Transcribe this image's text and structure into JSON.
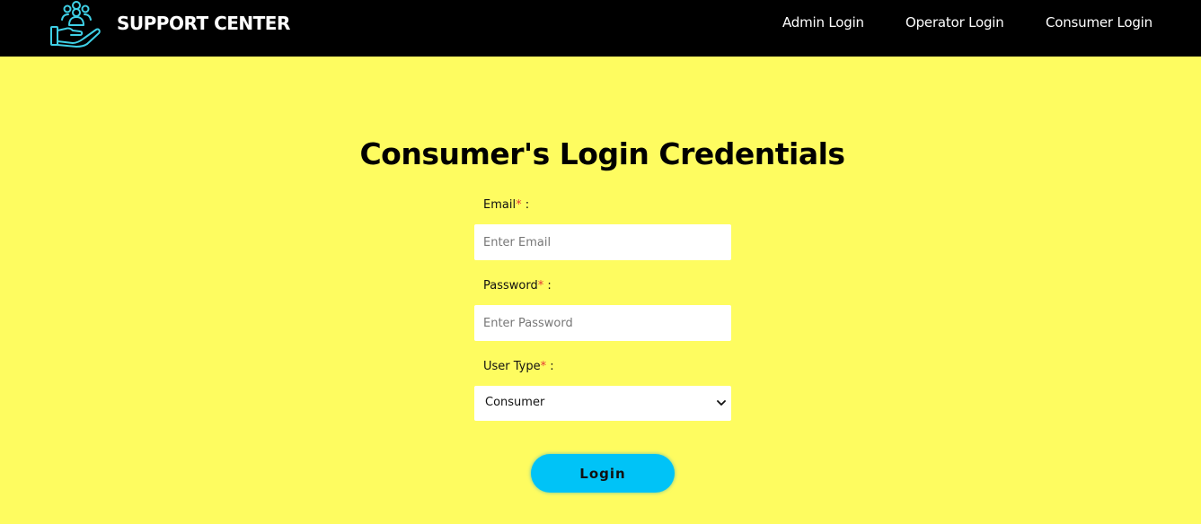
{
  "navbar": {
    "brand_name": "SUPPORT CENTER",
    "logo_icon": "helping-hand-people-icon",
    "links": [
      {
        "label": "Admin Login"
      },
      {
        "label": "Operator Login"
      },
      {
        "label": "Consumer Login"
      }
    ]
  },
  "form": {
    "title": "Consumer's Login Credentials",
    "email": {
      "label": "Email",
      "required_mark": "*",
      "separator": " :",
      "placeholder": "Enter Email",
      "value": ""
    },
    "password": {
      "label": "Password",
      "required_mark": "*",
      "separator": " :",
      "placeholder": "Enter Password",
      "value": ""
    },
    "user_type": {
      "label": "User Type",
      "required_mark": "*",
      "separator": " :",
      "selected": "Consumer"
    },
    "submit_label": "Login"
  },
  "colors": {
    "background": "#fefc60",
    "navbar": "#000000",
    "accent_button": "#00c3f7",
    "logo_stroke": "#3fd0e6",
    "required": "#e53935"
  }
}
